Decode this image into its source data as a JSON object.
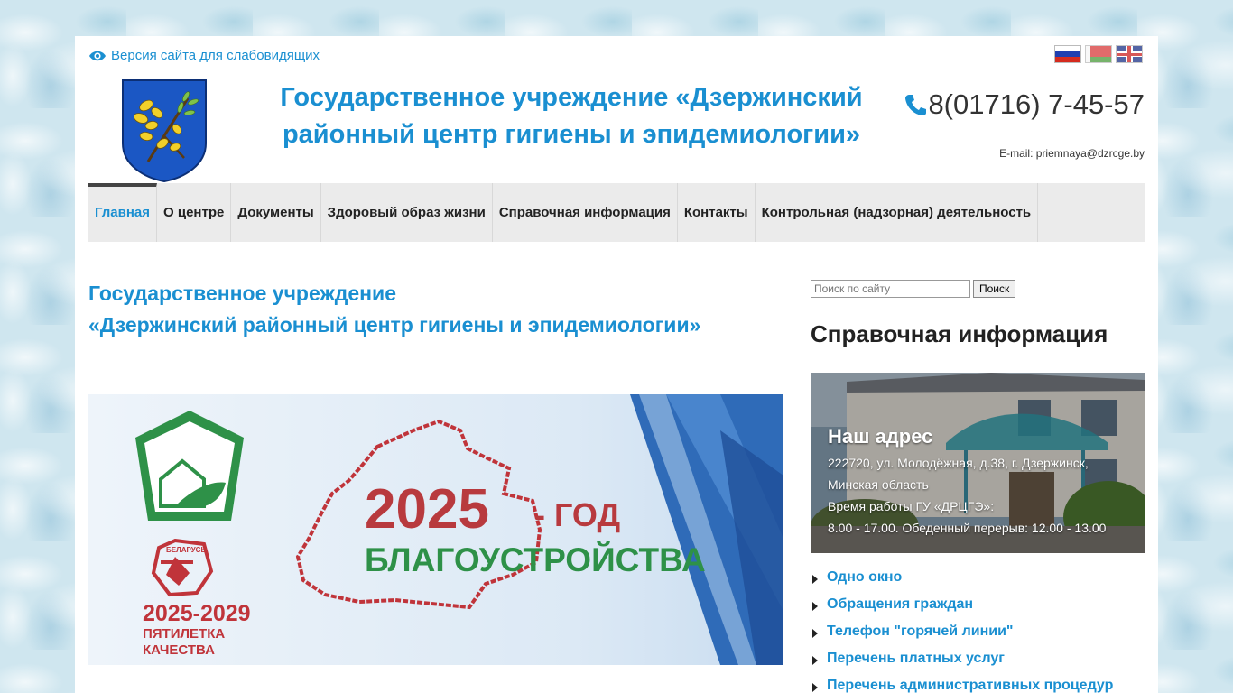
{
  "header": {
    "vision_link": "Версия сайта для слабовидящих",
    "title": "Государственное учреждение «Дзержинский районный центр гигиены и эпидемиологии»",
    "phone": "8(01716) 7-45-57",
    "email_label": "E-mail:",
    "email": "priemnaya@dzrcge.by",
    "languages": [
      "ru",
      "by",
      "en"
    ]
  },
  "nav": {
    "items": [
      {
        "label": "Главная",
        "active": true
      },
      {
        "label": "О центре"
      },
      {
        "label": "Документы"
      },
      {
        "label": "Здоровый образ жизни"
      },
      {
        "label": "Справочная информация"
      },
      {
        "label": "Контакты"
      },
      {
        "label": "Контрольная (надзорная) деятельность"
      }
    ]
  },
  "main": {
    "title_line1": "Государственное учреждение",
    "title_line2": "«Дзержинский районный центр гигиены и эпидемиологии»",
    "banner": {
      "year": "2025",
      "year_suffix": "- ГОД",
      "subtitle": "БЛАГОУСТРОЙСТВА",
      "badge_text": "БЕЛАРУСЬ",
      "period": "2025-2029",
      "period_line1": "ПЯТИЛЕТКА",
      "period_line2": "КАЧЕСТВА"
    }
  },
  "sidebar": {
    "search_placeholder": "Поиск по сайту",
    "search_button": "Поиск",
    "heading": "Справочная информация",
    "card": {
      "title": "Наш адрес",
      "address_line1": "222720, ул. Молодёжная, д.38, г. Дзержинск,",
      "address_line2": "Минская область",
      "hours_line1": "Время работы ГУ «ДРЦГЭ»:",
      "hours_line2": "8.00 - 17.00. Обеденный перерыв: 12.00 - 13.00"
    },
    "links": [
      "Одно окно",
      "Обращения граждан",
      "Телефон \"горячей линии\"",
      "Перечень платных услуг",
      "Перечень административных процедур"
    ]
  },
  "colors": {
    "accent": "#1a8fd1",
    "nav_bg": "#ebebeb",
    "banner_red": "#b83a3e",
    "banner_green": "#2e9148"
  }
}
